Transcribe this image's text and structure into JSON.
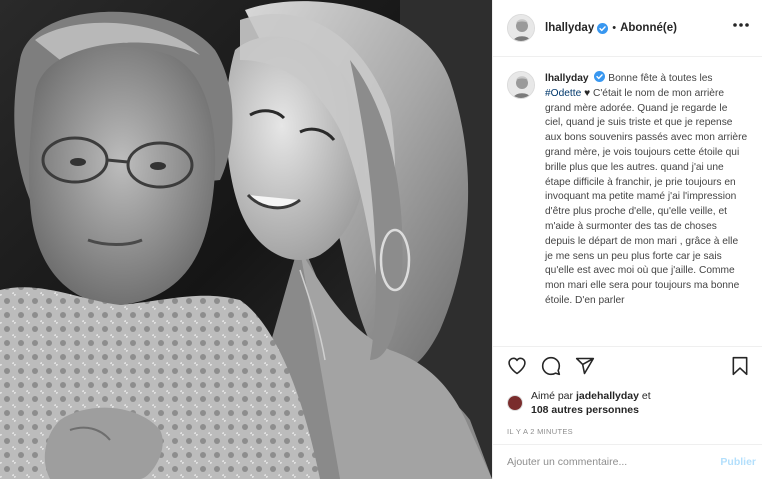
{
  "post": {
    "username": "lhallyday",
    "follow_separator": "•",
    "follow_status": "Abonné(e)",
    "verified_icon": "verified-badge-icon",
    "more_icon": "more-options-icon"
  },
  "caption": {
    "username": "lhallyday",
    "text_before_tag": "Bonne fête à toutes les ",
    "hashtag": "#Odette",
    "heart": "♥",
    "text_after_tag": " C'était le nom de mon arrière grand mère adorée. Quand je regarde le ciel, quand je suis triste et que je repense aux bons souvenirs passés avec mon arrière grand mère, je vois toujours cette étoile qui brille plus que les autres. quand j'ai une étape difficile à franchir, je prie toujours en invoquant ma petite mamé j'ai l'impression d'être plus proche d'elle, qu'elle veille, et m'aide à surmonter des tas de choses depuis le départ de mon mari , grâce à elle je me sens un peu plus forte car je sais qu'elle est avec moi où que j'aille. Comme mon mari elle sera pour toujours ma bonne étoile. D'en parler"
  },
  "actions": {
    "like_icon": "heart-icon",
    "comment_icon": "comment-icon",
    "share_icon": "paper-plane-icon",
    "save_icon": "bookmark-icon"
  },
  "likes": {
    "prefix": "Aimé par ",
    "liker": "jadehallyday",
    "middle": " et",
    "others": "108 autres personnes"
  },
  "timestamp": "IL Y A 2 MINUTES",
  "comment": {
    "placeholder": "Ajouter un commentaire...",
    "publish_label": "Publier"
  },
  "colors": {
    "link": "#00376b",
    "publish_disabled": "#b3dffc",
    "secondary_text": "#8e8e8e",
    "verified": "#3897f0"
  }
}
